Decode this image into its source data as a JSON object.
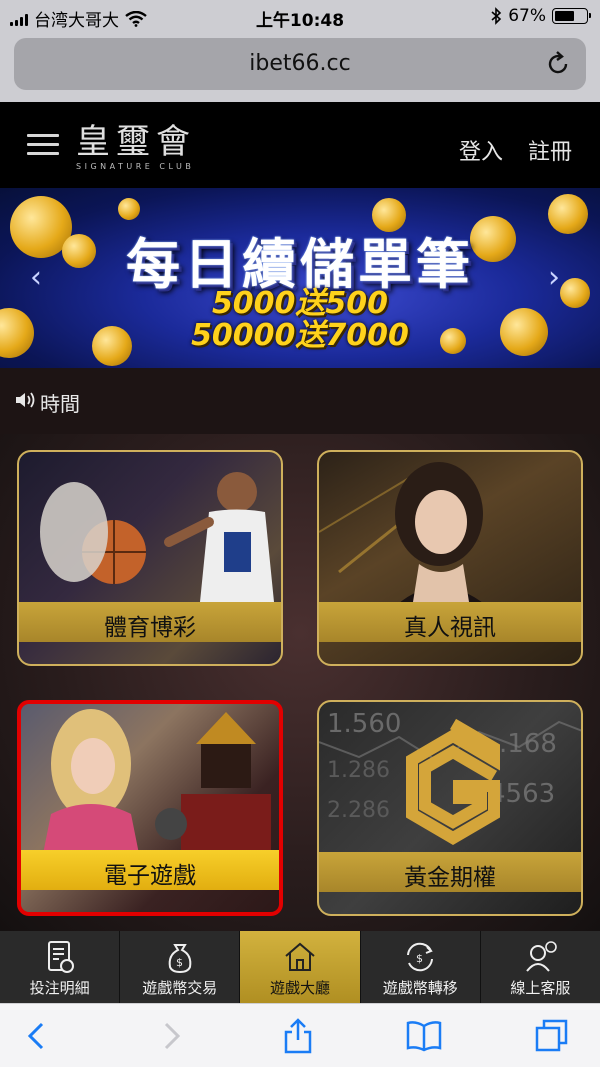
{
  "status_bar": {
    "carrier": "台湾大哥大",
    "time": "上午10:48",
    "battery_percent": "67%",
    "battery_level": 0.67
  },
  "browser": {
    "url": "ibet66.cc"
  },
  "site_header": {
    "logo_cn": "皇璽會",
    "logo_en": "SIGNATURE CLUB",
    "login_label": "登入",
    "register_label": "註冊"
  },
  "banner": {
    "title": "每日續儲單筆",
    "line1": "5000送500",
    "line2": "50000送7000"
  },
  "marquee": {
    "text": "時間"
  },
  "games": [
    {
      "label": "體育博彩"
    },
    {
      "label": "真人視訊"
    },
    {
      "label": "電子遊戲"
    },
    {
      "label": "黃金期權"
    }
  ],
  "bottom_nav": [
    {
      "label": "投注明細",
      "icon": "bet-slip-icon"
    },
    {
      "label": "遊戲幣交易",
      "icon": "money-bag-icon"
    },
    {
      "label": "遊戲大廳",
      "icon": "home-icon",
      "active": true
    },
    {
      "label": "遊戲幣轉移",
      "icon": "transfer-icon"
    },
    {
      "label": "線上客服",
      "icon": "support-icon"
    }
  ],
  "colors": {
    "gold": "#c8a43a",
    "selected_border": "#e20000",
    "header_bg": "#000000"
  }
}
